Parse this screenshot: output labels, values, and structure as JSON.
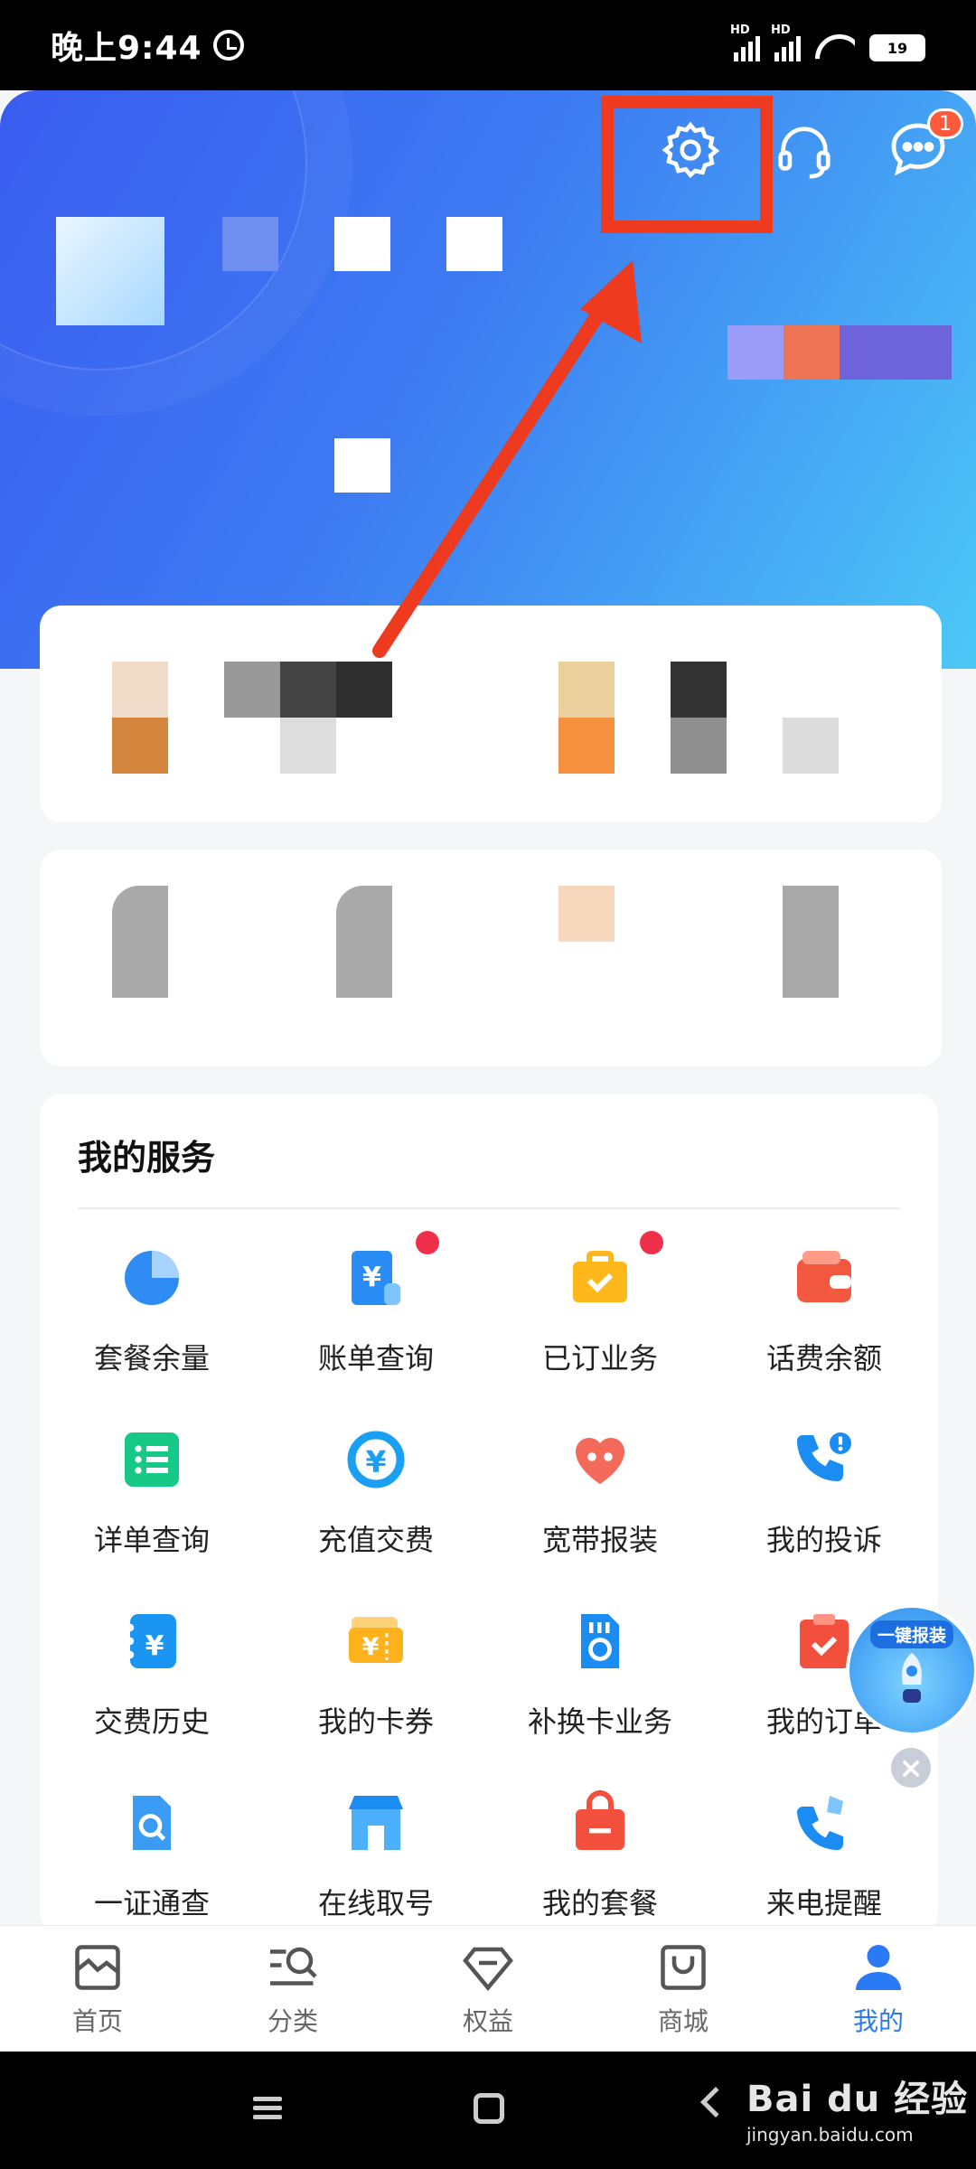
{
  "status_bar": {
    "time": "晚上9:44",
    "net1": "HD",
    "net2": "HD",
    "battery": "19"
  },
  "header": {
    "message_badge": "1"
  },
  "services": {
    "title": "我的服务",
    "items": [
      {
        "label": "套餐余量",
        "icon": "pie-chart-icon",
        "dot": false
      },
      {
        "label": "账单查询",
        "icon": "bill-icon",
        "dot": true
      },
      {
        "label": "已订业务",
        "icon": "briefcase-icon",
        "dot": true
      },
      {
        "label": "话费余额",
        "icon": "wallet-icon",
        "dot": false
      },
      {
        "label": "详单查询",
        "icon": "list-icon",
        "dot": false
      },
      {
        "label": "充值交费",
        "icon": "recharge-icon",
        "dot": false
      },
      {
        "label": "宽带报装",
        "icon": "heart-icon",
        "dot": false
      },
      {
        "label": "我的投诉",
        "icon": "phone-alert-icon",
        "dot": false
      },
      {
        "label": "交费历史",
        "icon": "history-icon",
        "dot": false
      },
      {
        "label": "我的卡券",
        "icon": "coupon-icon",
        "dot": false
      },
      {
        "label": "补换卡业务",
        "icon": "sim-swap-icon",
        "dot": false
      },
      {
        "label": "我的订单",
        "icon": "order-icon",
        "dot": false
      },
      {
        "label": "一证通查",
        "icon": "id-check-icon",
        "dot": false
      },
      {
        "label": "在线取号",
        "icon": "store-icon",
        "dot": false
      },
      {
        "label": "我的套餐",
        "icon": "bag-icon",
        "dot": false
      },
      {
        "label": "来电提醒",
        "icon": "call-reminder-icon",
        "dot": false
      }
    ]
  },
  "floating": {
    "report_label": "一键报装"
  },
  "bottom_nav": [
    {
      "label": "首页",
      "icon": "home-icon",
      "active": false
    },
    {
      "label": "分类",
      "icon": "category-icon",
      "active": false
    },
    {
      "label": "权益",
      "icon": "diamond-icon",
      "active": false
    },
    {
      "label": "商城",
      "icon": "shop-bag-icon",
      "active": false
    },
    {
      "label": "我的",
      "icon": "user-icon",
      "active": true
    }
  ],
  "watermark": {
    "brand": "Bai du 经验",
    "url": "jingyan.baidu.com"
  },
  "colors": {
    "accent": "#2b7af5",
    "highlight": "#ee3a1f",
    "dot": "#f0304a"
  }
}
